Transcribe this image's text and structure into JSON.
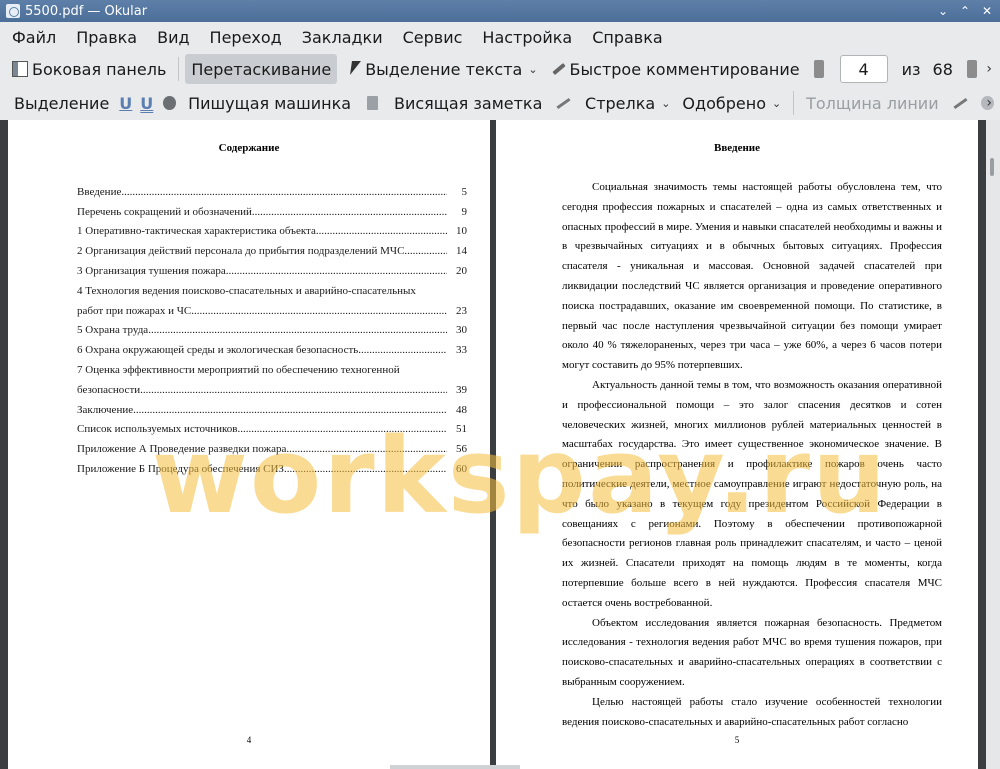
{
  "window": {
    "title": "5500.pdf  — Okular",
    "controls": [
      "⌄",
      "⌃",
      "✕"
    ]
  },
  "menu": [
    "Файл",
    "Правка",
    "Вид",
    "Переход",
    "Закладки",
    "Сервис",
    "Настройка",
    "Справка"
  ],
  "toolbar1": {
    "sidebar": "Боковая панель",
    "drag": "Перетаскивание",
    "text_select": "Выделение текста",
    "quick_comment": "Быстрое комментирование",
    "page_current": "4",
    "page_of": "из",
    "page_total": "68",
    "more": "›"
  },
  "toolbar2": {
    "selection": "Выделение",
    "u1": "U",
    "u2": "U",
    "typewriter": "Пишущая машинка",
    "hanging_note": "Висящая заметка",
    "arrow": "Стрелка",
    "approved": "Одобрено",
    "line_width": "Толщина линии",
    "more": "›"
  },
  "page_left": {
    "heading": "Содержание",
    "toc": [
      {
        "title": "Введение",
        "page": "5"
      },
      {
        "title": "Перечень сокращений и обозначений",
        "page": "9"
      },
      {
        "title": "1 Оперативно-тактическая характеристика объекта",
        "page": "10"
      },
      {
        "title": "2 Организация действий персонала до прибытия подразделений МЧС",
        "page": "14"
      },
      {
        "title": "3 Организация тушения пожара",
        "page": "20"
      },
      {
        "title": "4 Технология ведения поисково-спасательных и аварийно-спасательных",
        "page": ""
      },
      {
        "title": "работ при пожарах и ЧС",
        "page": "23"
      },
      {
        "title": "5 Охрана труда",
        "page": "30"
      },
      {
        "title": "6 Охрана окружающей среды и экологическая безопасность",
        "page": "33"
      },
      {
        "title": "7 Оценка эффективности мероприятий по обеспечению техногенной",
        "page": ""
      },
      {
        "title": "безопасности",
        "page": "39"
      },
      {
        "title": "Заключение",
        "page": "48"
      },
      {
        "title": "Список используемых источников",
        "page": "51"
      },
      {
        "title": "Приложение А Проведение разведки пожара",
        "page": "56"
      },
      {
        "title": "Приложение Б Процедура обеспечения СИЗ",
        "page": "60"
      }
    ],
    "page_number": "4"
  },
  "page_right": {
    "heading": "Введение",
    "paragraphs": [
      "Социальная значимость темы настоящей работы обусловлена тем, что сегодня профессия пожарных и спасателей – одна из самых ответственных и опасных профессий в мире. Умения и навыки спасателей необходимы и важны и в чрезвычайных ситуациях и в обычных бытовых ситуациях. Профессия спасателя - уникальная и массовая. Основной задачей спасателей при ликвидации последствий ЧС является организация и проведение оперативного поиска пострадавших, оказание им своевременной помощи. По статистике, в первый час после наступления чрезвычайной ситуации без помощи умирает около 40 % тяжелораненых, через три часа – уже 60%, а через 6 часов потери могут составить до 95% потерпевших.",
      "Актуальность данной темы в том, что возможность оказания оперативной и профессиональной помощи – это залог спасения десятков и сотен человеческих жизней, многих миллионов рублей материальных ценностей в масштабах государства. Это имеет существенное экономическое значение. В ограничении распространения и профилактике пожаров очень часто политические деятели, местное самоуправление играют недостаточную роль, на что было указано в текущем году президентом Российской Федерации в совещаниях с регионами. Поэтому в обеспечении противопожарной безопасности регионов главная роль принадлежит спасателям, и часто – ценой их жизней. Спасатели приходят на помощь людям в те моменты, когда потерпевшие больше всего в ней нуждаются. Профессия спасателя МЧС остается очень востребованной.",
      "Объектом исследования является пожарная безопасность. Предметом исследования - технология ведения работ МЧС во время тушения пожаров, при поисково-спасательных и аварийно-спасательных операциях в соответствии с выбранным сооружением.",
      "Целью настоящей работы стало изучение особенностей технологии ведения поисково-спасательных и аварийно-спасательных работ согласно"
    ],
    "page_number": "5"
  },
  "watermark": "workspay.ru"
}
